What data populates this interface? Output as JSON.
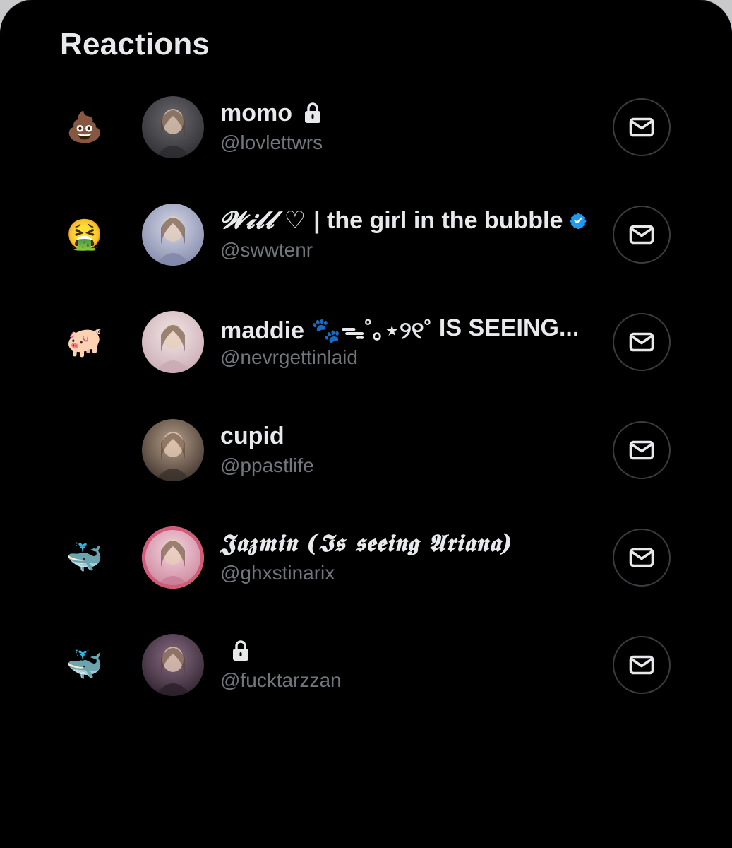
{
  "header": {
    "title": "Reactions"
  },
  "reactions": [
    {
      "emoji": "💩",
      "name": "momo",
      "name_suffix": "",
      "handle": "@lovlettwrs",
      "locked": true,
      "verified": false,
      "avatar_colors": [
        "#6b6a6f",
        "#2c2b30"
      ]
    },
    {
      "emoji": "🤮",
      "name": "𝓦𝓲𝓵𝓵 ♡",
      "name_suffix": "| the girl in the bubble",
      "handle": "@swwtenr",
      "locked": false,
      "verified": true,
      "avatar_colors": [
        "#d7d9e8",
        "#7f86a8"
      ]
    },
    {
      "emoji": "🐖",
      "name": "maddie 🐾ᯓ˚｡⋆୨୧˚",
      "name_suffix": "IS SEEING...",
      "handle": "@nevrgettinlaid",
      "locked": false,
      "verified": false,
      "avatar_colors": [
        "#f1e7e6",
        "#c9a9b3"
      ]
    },
    {
      "emoji": "🐮",
      "name": "cupid",
      "name_suffix": "",
      "handle": "@ppastlife",
      "locked": false,
      "verified": false,
      "avatar_colors": [
        "#b8a08a",
        "#3a2f2a"
      ]
    },
    {
      "emoji": "🐳",
      "name": "𝕵𝖆𝖟𝖒𝖎𝖓 (𝕴𝖘 𝖘𝖊𝖊𝖎𝖓𝖌 𝕬𝖗𝖎𝖆𝖓𝖆)",
      "name_suffix": "",
      "handle": "@ghxstinarix",
      "locked": false,
      "verified": false,
      "avatar_colors": [
        "#f2d5de",
        "#c87c95"
      ],
      "avatar_ring": "#d45a7a"
    },
    {
      "emoji": "🐳",
      "name": "",
      "name_suffix": "",
      "handle": "@fucktarzzan",
      "locked": true,
      "verified": false,
      "avatar_colors": [
        "#8c6d86",
        "#2a1f2a"
      ]
    }
  ],
  "icons": {
    "dm": "envelope-icon",
    "lock": "lock-icon",
    "verified": "verified-badge-icon"
  },
  "colors": {
    "background": "#000000",
    "text_primary": "#e7e9ea",
    "text_secondary": "#71767b",
    "verified_blue": "#1d9bf0",
    "button_border": "#3a3d40"
  }
}
